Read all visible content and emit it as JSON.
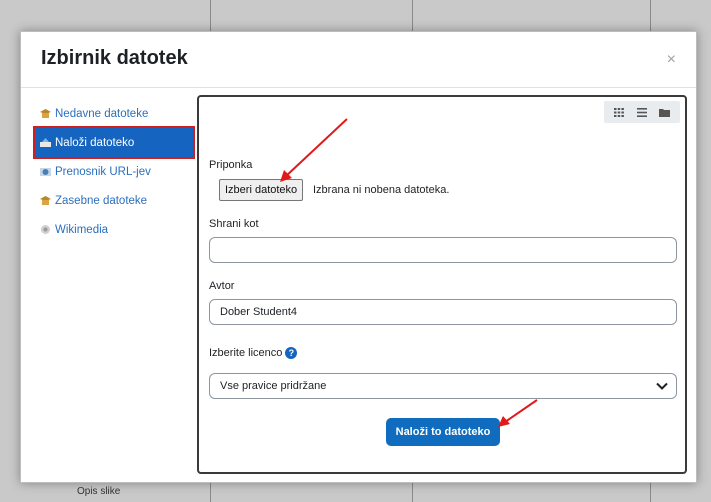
{
  "modal": {
    "title": "Izbirnik datotek",
    "close_glyph": "×"
  },
  "sidebar": {
    "items": [
      {
        "label": "Nedavne datoteke",
        "icon": "recent-files-icon",
        "active": false
      },
      {
        "label": "Naloži datoteko",
        "icon": "upload-icon",
        "active": true
      },
      {
        "label": "Prenosnik URL-jev",
        "icon": "url-downloader-icon",
        "active": false
      },
      {
        "label": "Zasebne datoteke",
        "icon": "private-files-icon",
        "active": false
      },
      {
        "label": "Wikimedia",
        "icon": "wikimedia-icon",
        "active": false
      }
    ]
  },
  "toolbar": {
    "view_icons": [
      "grid-view-icon",
      "list-view-icon",
      "folder-view-icon"
    ]
  },
  "form": {
    "attachment_label": "Priponka",
    "choose_file_label": "Izberi datoteko",
    "file_status": "Izbrana ni nobena datoteka.",
    "save_as_label": "Shrani kot",
    "save_as_value": "",
    "author_label": "Avtor",
    "author_value": "Dober Student4",
    "license_label": "Izberite licenco",
    "license_value": "Vse pravice pridržane",
    "upload_button": "Naloži to datoteko"
  },
  "background": {
    "caption": "Opis slike"
  },
  "colors": {
    "accent": "#0f6cbf",
    "active_item": "#1565c0",
    "highlight_border": "#d01f1f",
    "annotation_arrow": "#e0191b"
  }
}
